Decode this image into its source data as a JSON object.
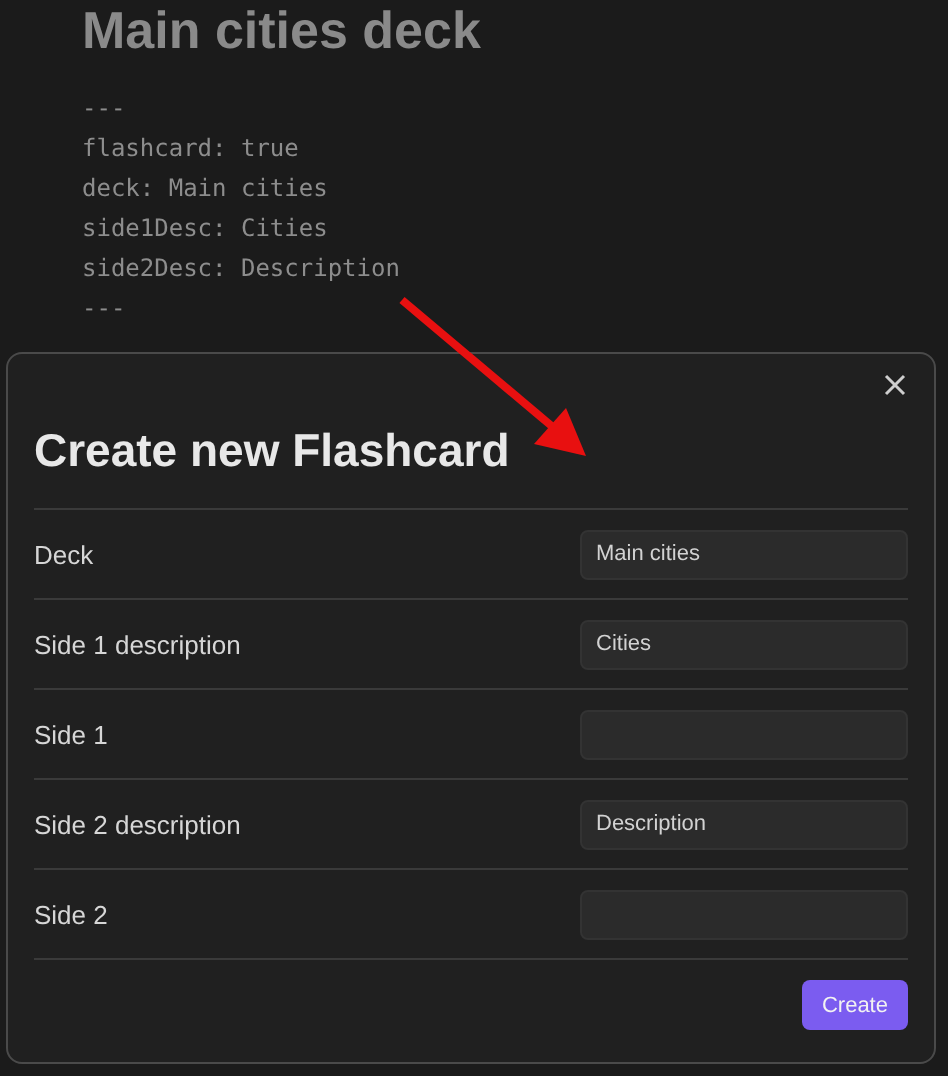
{
  "note": {
    "title": "Main cities deck",
    "frontmatter": [
      "---",
      "flashcard: true",
      "deck: Main cities",
      "side1Desc: Cities",
      "side2Desc: Description",
      "---"
    ]
  },
  "modal": {
    "title": "Create new Flashcard",
    "fields": [
      {
        "label": "Deck",
        "value": "Main cities"
      },
      {
        "label": "Side 1 description",
        "value": "Cities"
      },
      {
        "label": "Side 1"
      },
      {
        "label": "Side 2 description",
        "value": "Description"
      },
      {
        "label": "Side 2"
      }
    ],
    "button": "Create"
  }
}
